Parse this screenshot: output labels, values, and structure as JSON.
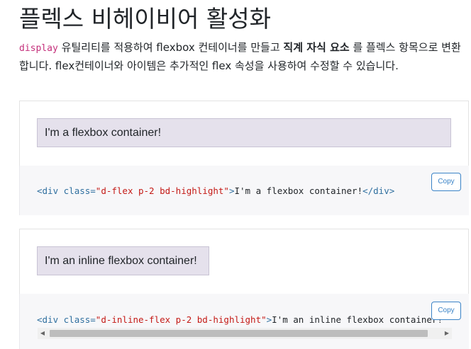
{
  "page": {
    "title": "플렉스 비헤이비어 활성화",
    "description": {
      "code": "display",
      "part1": " 유틸리티를 적용하여 flexbox 컨테이너를 만들고 ",
      "strong": "직계 자식 요소",
      "part2": " 를 플렉스 항목으로 변환합니다. flex컨테이너와 아이템은 추가적인 flex 속성을 사용하여 수정할 수 있습니다."
    }
  },
  "examples": [
    {
      "demo_text": "I'm a flexbox container!",
      "code": {
        "open": "<div",
        "attr": "class=",
        "value": "\"d-flex p-2 bd-highlight\"",
        "gt": ">",
        "text": "I'm a flexbox container!",
        "close": "</div>"
      },
      "copy_label": "Copy"
    },
    {
      "demo_text": "I'm an inline flexbox container!",
      "code": {
        "open": "<div",
        "attr": "class=",
        "value": "\"d-inline-flex p-2 bd-highlight\"",
        "gt": ">",
        "text": "I'm an inline flexbox container!"
      },
      "copy_label": "Copy",
      "scroll_left_icon": "◀",
      "scroll_right_icon": "▶"
    }
  ],
  "colors": {
    "code_purple": "#c4307b",
    "code_tag": "#2f6f9f",
    "code_value": "#c41a16",
    "copy_blue": "#3a83c7",
    "highlight_bg": "#e5e1ec"
  }
}
